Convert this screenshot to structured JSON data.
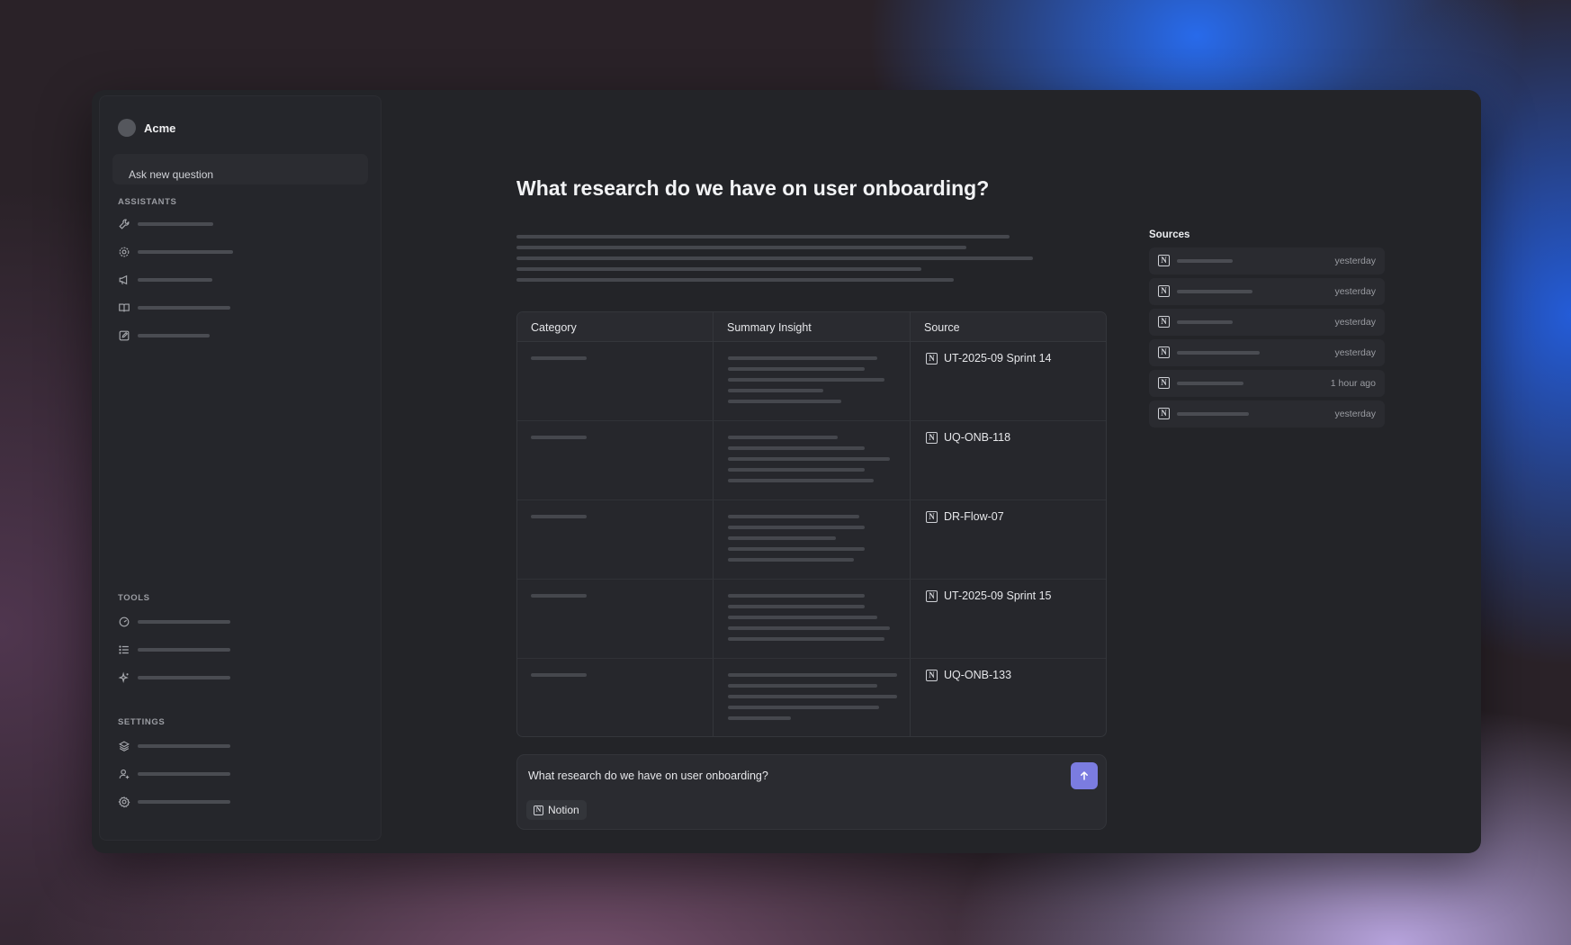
{
  "brand": {
    "name": "Acme"
  },
  "sidebar": {
    "ask_button": "Ask new question",
    "sections": {
      "assistants": "ASSISTANTS",
      "tools": "TOOLS",
      "settings": "SETTINGS"
    },
    "assistants_icons": [
      "wrench-icon",
      "gear-icon",
      "megaphone-icon",
      "book-icon",
      "edit-icon"
    ],
    "tools_icons": [
      "gauge-icon",
      "list-icon",
      "sparkle-icon"
    ],
    "settings_icons": [
      "layers-icon",
      "user-add-icon",
      "gear-icon"
    ]
  },
  "main": {
    "title": "What research do we have on user onboarding?",
    "table": {
      "headers": [
        "Category",
        "Summary Insight",
        "Source"
      ],
      "rows": [
        {
          "source": "UT-2025-09 Sprint 14"
        },
        {
          "source": "UQ-ONB-118"
        },
        {
          "source": "DR-Flow-07"
        },
        {
          "source": "UT-2025-09 Sprint 15"
        },
        {
          "source": "UQ-ONB-133"
        }
      ]
    },
    "composer": {
      "value": "What research do we have on user onboarding?",
      "chip": "Notion",
      "send_icon": "arrow-up-icon"
    }
  },
  "sources": {
    "title": "Sources",
    "items": [
      {
        "time": "yesterday"
      },
      {
        "time": "yesterday"
      },
      {
        "time": "yesterday"
      },
      {
        "time": "yesterday"
      },
      {
        "time": "1 hour ago"
      },
      {
        "time": "yesterday"
      }
    ]
  },
  "colors": {
    "accent": "#7b7ce0",
    "app_bg": "#232428",
    "sidebar_bg": "#25262b"
  }
}
